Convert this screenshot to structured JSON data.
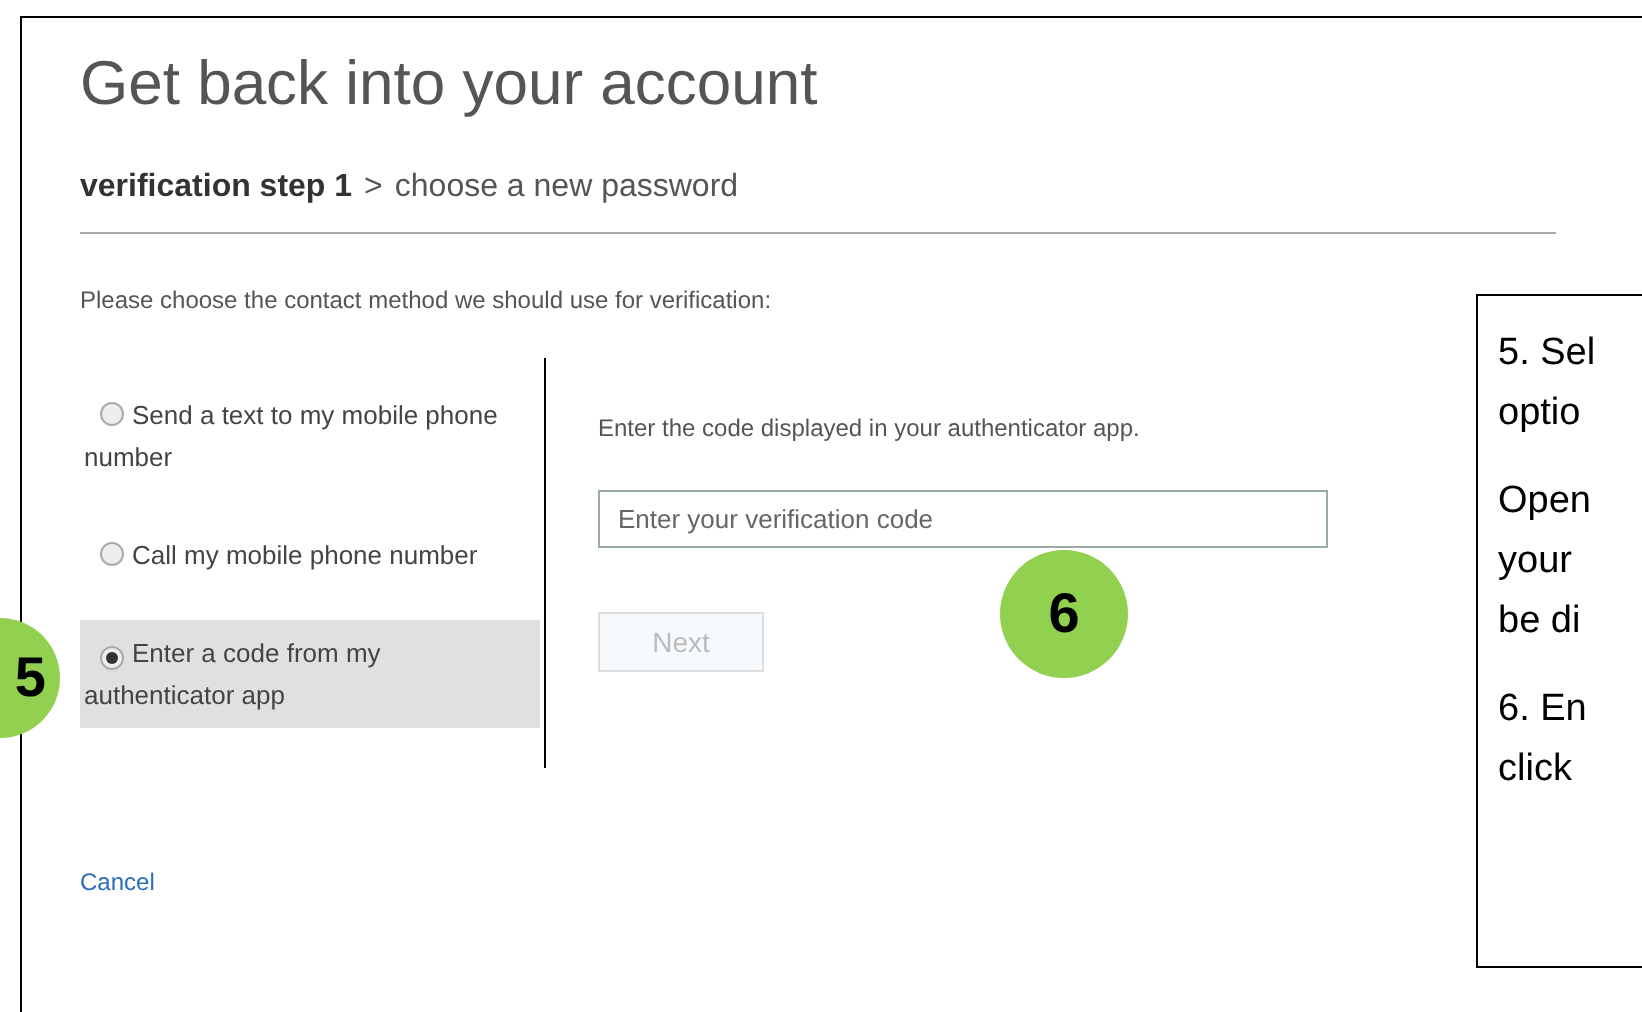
{
  "title": "Get back into your account",
  "steps": {
    "current": "verification step 1",
    "separator": ">",
    "next": "choose a new password"
  },
  "prompt": "Please choose the contact method we should use for verification:",
  "options": [
    {
      "label": "Send a text to my mobile phone number",
      "selected": false
    },
    {
      "label": "Call my mobile phone number",
      "selected": false
    },
    {
      "label": "Enter a code from my authenticator app",
      "selected": true
    }
  ],
  "instruction": "Enter the code displayed in your authenticator app.",
  "code_field": {
    "placeholder": "Enter your verification code"
  },
  "next_button": {
    "label": "Next",
    "disabled": true
  },
  "cancel_link": "Cancel",
  "markers": [
    "5",
    "6"
  ],
  "callout": {
    "paragraphs": [
      [
        "5. Sel",
        "optio"
      ],
      [
        "Open",
        "your",
        "be di"
      ],
      [
        "6. En",
        "click"
      ]
    ]
  }
}
